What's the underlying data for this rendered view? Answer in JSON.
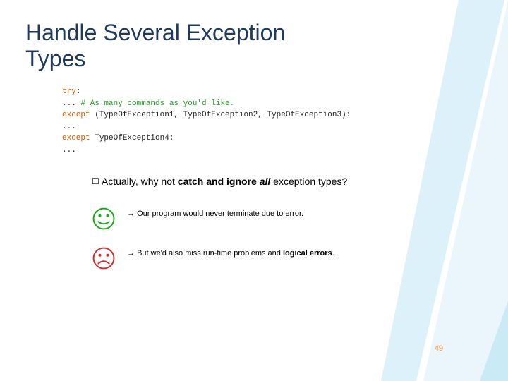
{
  "title": "Handle Several Exception Types",
  "code": {
    "l1_kw": "try",
    "l1_colon": ":",
    "l2_indent": "   ... ",
    "l2_cmt": "# As many commands as you'd like.",
    "l3_kw": "except",
    "l3_rest": " (TypeOfException1, TypeOfException2, TypeOfException3):",
    "l4": "   ...",
    "l5_kw": "except",
    "l5_sp": " ",
    "l5_ex": "TypeOfException4",
    "l5_colon": ":",
    "l6": "   ..."
  },
  "bullet": {
    "square": "☐",
    "t1": " Actually, why not ",
    "t2": "catch and ignore ",
    "t3": "all",
    "t4": " exception types?"
  },
  "point1": {
    "arrow": "→ ",
    "text": "Our program would never terminate due to error."
  },
  "point2": {
    "arrow": "→ ",
    "t1": "But we'd also miss run-time problems and ",
    "t2": "logical errors",
    "t3": "."
  },
  "pagenum": "49"
}
